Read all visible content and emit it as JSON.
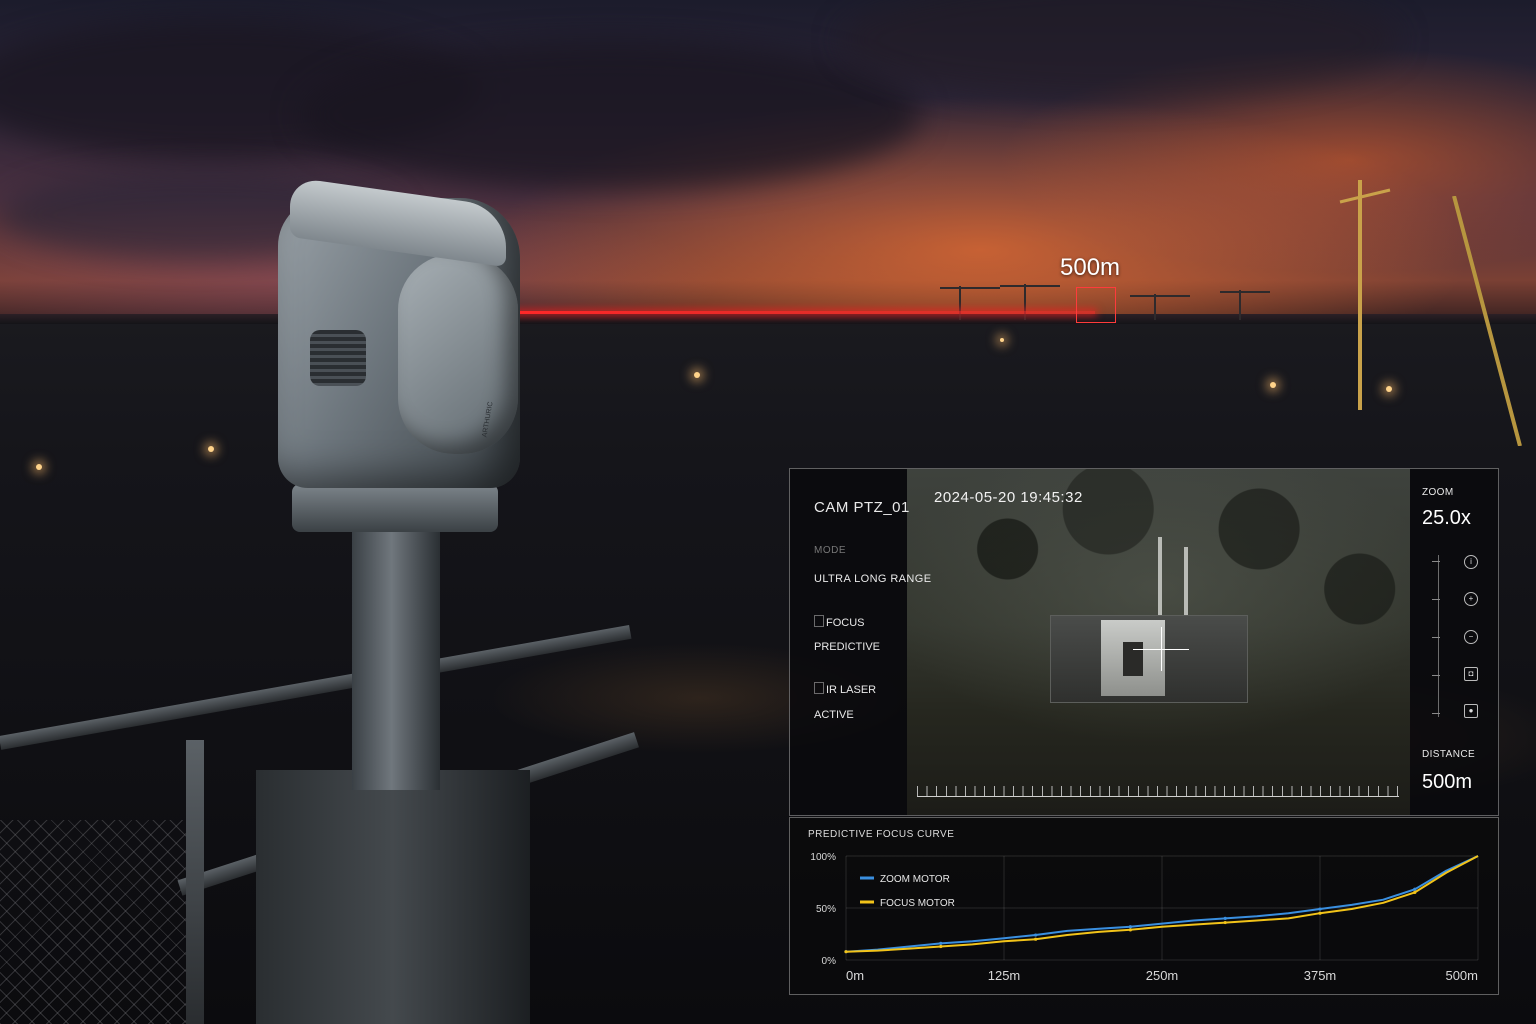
{
  "scene": {
    "target_distance_label": "500m",
    "camera_brand_text": "ARTHURIC"
  },
  "video": {
    "camera_id": "CAM PTZ_01",
    "timestamp": "2024-05-20 19:45:32",
    "mode_label": "MODE",
    "mode_value": "ULTRA LONG RANGE",
    "focus_label": "FOCUS",
    "focus_value": "PREDICTIVE",
    "laser_label": "IR LASER",
    "laser_value": "ACTIVE",
    "zoom_label": "ZOOM",
    "zoom_value": "25.0x",
    "distance_label": "DISTANCE",
    "distance_value": "500m",
    "controls": [
      {
        "icon": "info-icon",
        "glyph": "i"
      },
      {
        "icon": "plus-icon",
        "glyph": "+"
      },
      {
        "icon": "minus-icon",
        "glyph": "−"
      },
      {
        "icon": "camera-icon",
        "glyph": "◘"
      },
      {
        "icon": "record-icon",
        "glyph": "●"
      }
    ]
  },
  "colors": {
    "laser": "#ff2a2a",
    "zoom_series": "#3a8fe0",
    "focus_series": "#f2c319"
  },
  "chart_data": {
    "type": "line",
    "title": "PREDICTIVE FOCUS CURVE",
    "xlabel": "",
    "ylabel": "",
    "x_ticks": [
      "0m",
      "125m",
      "250m",
      "375m",
      "500m"
    ],
    "y_ticks": [
      "0%",
      "50%",
      "100%"
    ],
    "xlim": [
      0,
      500
    ],
    "ylim": [
      0,
      100
    ],
    "grid": true,
    "legend_position": "top-left",
    "series": [
      {
        "name": "ZOOM MOTOR",
        "color": "#3a8fe0",
        "x": [
          0,
          25,
          50,
          75,
          100,
          125,
          150,
          175,
          200,
          225,
          250,
          275,
          300,
          325,
          350,
          375,
          400,
          425,
          450,
          475,
          500
        ],
        "y": [
          8,
          10,
          13,
          16,
          18,
          21,
          24,
          28,
          30,
          32,
          35,
          38,
          40,
          42,
          45,
          49,
          53,
          58,
          68,
          86,
          100
        ]
      },
      {
        "name": "FOCUS MOTOR",
        "color": "#f2c319",
        "x": [
          0,
          25,
          50,
          75,
          100,
          125,
          150,
          175,
          200,
          225,
          250,
          275,
          300,
          325,
          350,
          375,
          400,
          425,
          450,
          475,
          500
        ],
        "y": [
          8,
          9,
          11,
          13,
          15,
          18,
          20,
          24,
          27,
          29,
          32,
          34,
          36,
          38,
          40,
          45,
          49,
          55,
          65,
          84,
          100
        ]
      }
    ]
  }
}
